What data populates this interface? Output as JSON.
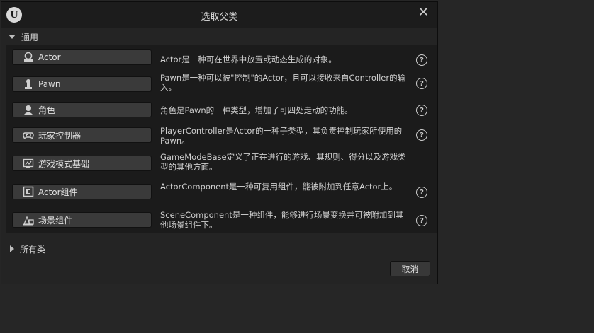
{
  "window": {
    "title": "选取父类",
    "logo_icon": "unreal-engine-logo",
    "logo_letter": "U",
    "close_glyph": "✕"
  },
  "common_section": {
    "label": "通用",
    "items": [
      {
        "label": "Actor",
        "icon": "actor-icon",
        "description": "Actor是一种可在世界中放置或动态生成的对象。",
        "help": "?"
      },
      {
        "label": "Pawn",
        "icon": "pawn-icon",
        "description": "Pawn是一种可以被\"控制\"的Actor，且可以接收来自Controller的输入。",
        "help": "?"
      },
      {
        "label": "角色",
        "icon": "character-icon",
        "description": "角色是Pawn的一种类型，增加了可四处走动的功能。",
        "help": "?"
      },
      {
        "label": "玩家控制器",
        "icon": "gamepad-icon",
        "description": "PlayerController是Actor的一种子类型，其负责控制玩家所使用的Pawn。",
        "help": "?"
      },
      {
        "label": "游戏模式基础",
        "icon": "game-mode-icon",
        "description": "GameModeBase定义了正在进行的游戏、其规则、得分以及游戏类型的其他方面。",
        "help": ""
      },
      {
        "label": "Actor组件",
        "icon": "actor-component-icon",
        "description": "ActorComponent是一种可复用组件，能被附加到任意Actor上。",
        "help": "?"
      },
      {
        "label": "场景组件",
        "icon": "scene-component-icon",
        "description": "SceneComponent是一种组件，能够进行场景变换并可被附加到其他场景组件下。",
        "help": "?"
      }
    ]
  },
  "all_classes_section": {
    "label": "所有类"
  },
  "footer": {
    "cancel_label": "取消"
  }
}
